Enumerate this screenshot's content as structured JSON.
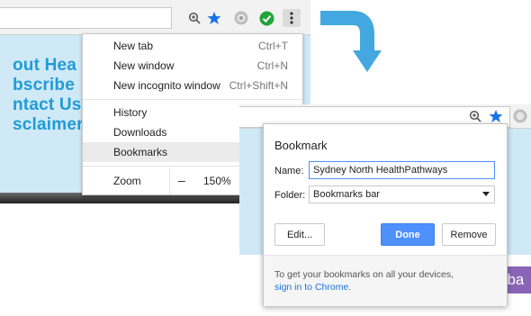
{
  "left": {
    "page_links": [
      "out Hea",
      "bscribe",
      "ntact Us",
      "sclaimer"
    ]
  },
  "menu": {
    "items": [
      {
        "label": "New tab",
        "shortcut": "Ctrl+T"
      },
      {
        "label": "New window",
        "shortcut": "Ctrl+N"
      },
      {
        "label": "New incognito window",
        "shortcut": "Ctrl+Shift+N"
      },
      {
        "label": "History",
        "shortcut": ""
      },
      {
        "label": "Downloads",
        "shortcut": ""
      },
      {
        "label": "Bookmarks",
        "shortcut": ""
      }
    ],
    "zoom": {
      "label": "Zoom",
      "minus": "–",
      "value": "150%"
    }
  },
  "dialog": {
    "title": "Bookmark",
    "name_label": "Name:",
    "name_value": "Sydney North HealthPathways",
    "folder_label": "Folder:",
    "folder_value": "Bookmarks bar",
    "edit_label": "Edit...",
    "done_label": "Done",
    "remove_label": "Remove",
    "footer_line1": "To get your bookmarks on all your devices,",
    "footer_link": "sign in to Chrome",
    "footer_end": "."
  },
  "right": {
    "purple_text": "dba"
  },
  "colors": {
    "star": "#1a73e8",
    "check": "#22a33a",
    "page_bg": "#cfe9f6",
    "link": "#1f9bd7",
    "arrow": "#42a8df",
    "done": "#4d90fe"
  }
}
